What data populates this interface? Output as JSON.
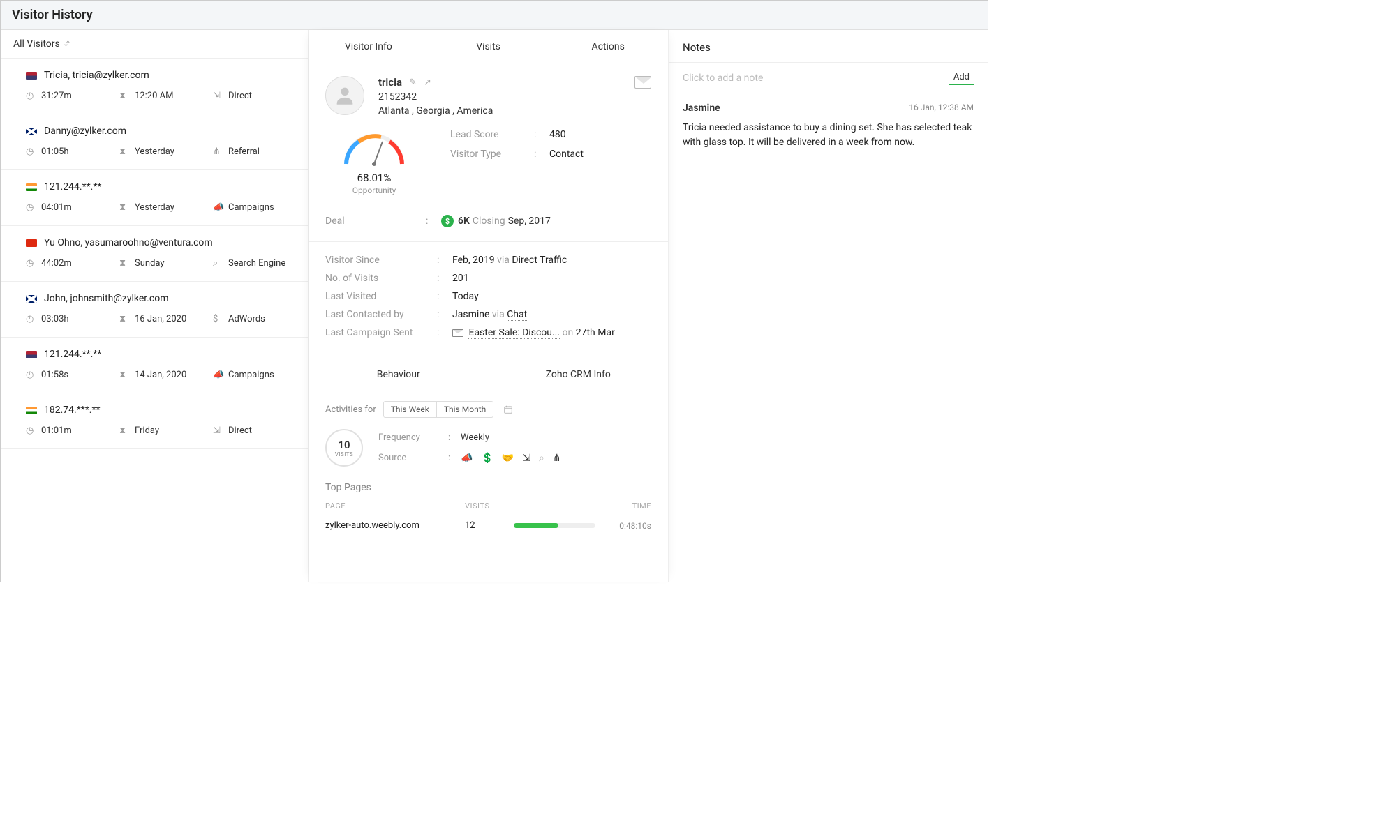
{
  "header": {
    "title": "Visitor History"
  },
  "filter": {
    "label": "All Visitors"
  },
  "visitors": [
    {
      "flag": "us",
      "name": "Tricia, tricia@zylker.com",
      "duration": "31:27m",
      "when": "12:20 AM",
      "source": "Direct",
      "srcicon": "direct"
    },
    {
      "flag": "uk",
      "name": "Danny@zylker.com",
      "duration": "01:05h",
      "when": "Yesterday",
      "source": "Referral",
      "srcicon": "referral"
    },
    {
      "flag": "in",
      "name": "121.244.**.**",
      "duration": "04:01m",
      "when": "Yesterday",
      "source": "Campaigns",
      "srcicon": "campaign"
    },
    {
      "flag": "cn",
      "name": "Yu Ohno, yasumaroohno@ventura.com",
      "duration": "44:02m",
      "when": "Sunday",
      "source": "Search Engine",
      "srcicon": "search"
    },
    {
      "flag": "uk",
      "name": "John, johnsmith@zylker.com",
      "duration": "03:03h",
      "when": "16 Jan, 2020",
      "source": "AdWords",
      "srcicon": "adwords"
    },
    {
      "flag": "us",
      "name": "121.244.**.**",
      "duration": "01:58s",
      "when": "14 Jan, 2020",
      "source": "Campaigns",
      "srcicon": "campaign"
    },
    {
      "flag": "in",
      "name": "182.74.***.**",
      "duration": "01:01m",
      "when": "Friday",
      "source": "Direct",
      "srcicon": "direct"
    }
  ],
  "tabs": {
    "info": "Visitor Info",
    "visits": "Visits",
    "actions": "Actions"
  },
  "profile": {
    "name": "tricia",
    "id": "2152342",
    "location": "Atlanta , Georgia , America"
  },
  "opportunity": {
    "pct": "68.01%",
    "label": "Opportunity"
  },
  "score": {
    "lead_label": "Lead Score",
    "lead_value": "480",
    "type_label": "Visitor Type",
    "type_value": "Contact"
  },
  "deal": {
    "label": "Deal",
    "amount": "6K",
    "closing": "Closing",
    "date": "Sep, 2017"
  },
  "info": {
    "since_label": "Visitor Since",
    "since_val": "Feb, 2019",
    "since_via": "via",
    "since_src": "Direct Traffic",
    "visits_label": "No. of Visits",
    "visits_val": "201",
    "last_label": "Last Visited",
    "last_val": "Today",
    "contact_label": "Last Contacted by",
    "contact_who": "Jasmine",
    "contact_via": "via",
    "contact_ch": "Chat",
    "camp_label": "Last Campaign Sent",
    "camp_name": "Easter Sale: Discou...",
    "camp_on": "on",
    "camp_date": "27th Mar"
  },
  "subtabs": {
    "behaviour": "Behaviour",
    "crm": "Zoho CRM Info"
  },
  "activities": {
    "label": "Activities for",
    "week": "This Week",
    "month": "This Month"
  },
  "visitsBlock": {
    "count": "10",
    "label": "VISITS",
    "freq_label": "Frequency",
    "freq_val": "Weekly",
    "src_label": "Source"
  },
  "topPages": {
    "title": "Top Pages",
    "h_page": "PAGE",
    "h_visits": "VISITS",
    "h_time": "TIME",
    "rows": [
      {
        "page": "zylker-auto.weebly.com",
        "visits": "12",
        "time": "0:48:10s"
      }
    ]
  },
  "notes": {
    "title": "Notes",
    "placeholder": "Click to add a note",
    "add": "Add",
    "items": [
      {
        "author": "Jasmine",
        "time": "16 Jan,  12:38 AM",
        "body": "Tricia needed assistance to buy a dining set. She has selected teak with glass top. It will be delivered in a week from now."
      }
    ]
  }
}
